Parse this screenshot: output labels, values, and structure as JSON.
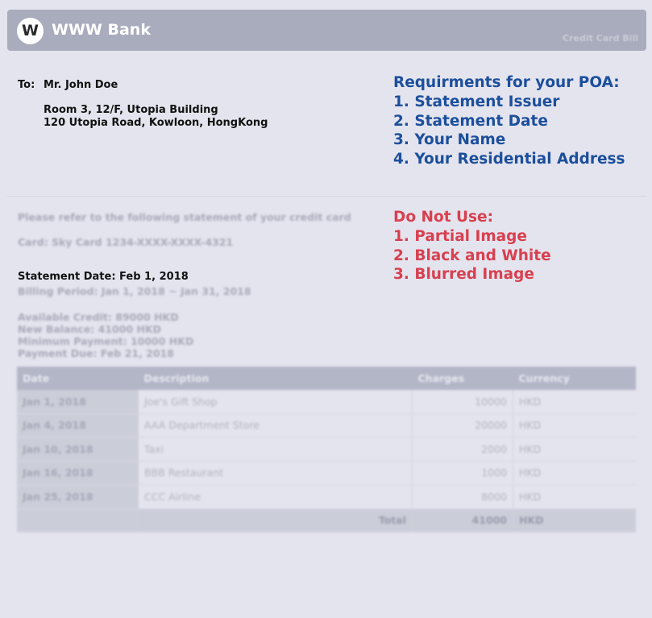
{
  "header": {
    "logo_letter": "W",
    "bank_name": "WWW Bank",
    "doc_type": "Credit Card Bill"
  },
  "recipient": {
    "to_label": "To:",
    "name": "Mr. John Doe",
    "address_line1": "Room 3, 12/F, Utopia Building",
    "address_line2": "120 Utopia Road, Kowloon, HongKong"
  },
  "requirements": {
    "title": "Requirments for your POA:",
    "items": [
      "1. Statement Issuer",
      "2. Statement Date",
      "3. Your Name",
      "4. Your Residential Address"
    ]
  },
  "do_not_use": {
    "title": "Do Not Use:",
    "items": [
      "1. Partial Image",
      "2. Black and White",
      "3. Blurred Image"
    ]
  },
  "statement": {
    "intro": "Please refer to the following statement of your credit card",
    "card": "Card: Sky Card 1234-XXXX-XXXX-4321",
    "statement_date": "Statement Date: Feb 1, 2018",
    "billing_period": "Billing Period: Jan 1, 2018 ~ Jan 31, 2018",
    "available_credit": "Available Credit: 89000 HKD",
    "new_balance": "New Balance: 41000 HKD",
    "minimum_payment": "Minimum Payment: 10000 HKD",
    "payment_due": "Payment Due: Feb 21, 2018"
  },
  "table": {
    "headers": [
      "Date",
      "Description",
      "Charges",
      "Currency"
    ],
    "rows": [
      [
        "Jan 1, 2018",
        "Joe's Gift Shop",
        "10000",
        "HKD"
      ],
      [
        "Jan 4, 2018",
        "AAA Department Store",
        "20000",
        "HKD"
      ],
      [
        "Jan 10, 2018",
        "Taxi",
        "2000",
        "HKD"
      ],
      [
        "Jan 16, 2018",
        "BBB Restaurant",
        "1000",
        "HKD"
      ],
      [
        "Jan 25, 2018",
        "CCC Airline",
        "8000",
        "HKD"
      ]
    ],
    "total_label": "Total",
    "total_value": "41000",
    "total_currency": "HKD"
  }
}
